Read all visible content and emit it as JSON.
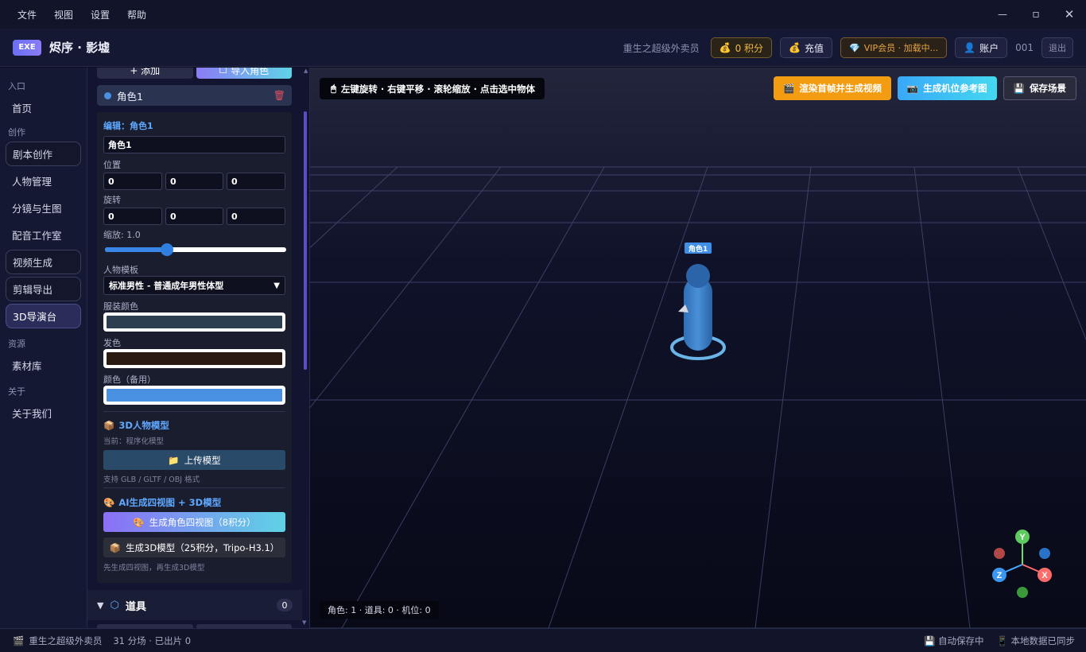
{
  "menubar": {
    "items": [
      "文件",
      "视图",
      "设置",
      "帮助"
    ]
  },
  "window_controls": {
    "minimize": "—",
    "maximize": "▫",
    "close": "✕"
  },
  "topbar": {
    "logo_text": "EXE",
    "title": "烬序 · 影墟",
    "user_name": "重生之超级外卖员",
    "points_label": "0 积分",
    "recharge_label": "充值",
    "vip_label": "VIP会员 · 加载中...",
    "account_label": "账户",
    "user_id": "001",
    "logout_label": "退出"
  },
  "sidebar": {
    "sections": [
      {
        "title": "入口",
        "items": [
          {
            "label": "首页",
            "style": "plain"
          }
        ]
      },
      {
        "title": "创作",
        "items": [
          {
            "label": "剧本创作",
            "style": "boxed"
          },
          {
            "label": "人物管理",
            "style": "plain"
          },
          {
            "label": "分镜与生图",
            "style": "plain"
          },
          {
            "label": "配音工作室",
            "style": "plain"
          },
          {
            "label": "视频生成",
            "style": "boxed"
          },
          {
            "label": "剪辑导出",
            "style": "boxed"
          },
          {
            "label": "3D导演台",
            "style": "active"
          }
        ]
      },
      {
        "title": "资源",
        "items": [
          {
            "label": "素材库",
            "style": "plain"
          }
        ]
      },
      {
        "title": "关于",
        "items": [
          {
            "label": "关于我们",
            "style": "plain"
          }
        ]
      }
    ]
  },
  "panel": {
    "add_label": "+ 添加",
    "import_label": "导入角色",
    "character_name": "角色1",
    "edit_title": "编辑：角色1",
    "name_value": "角色1",
    "position_label": "位置",
    "position": [
      "0",
      "0",
      "0"
    ],
    "rotation_label": "旋转",
    "rotation": [
      "0",
      "0",
      "0"
    ],
    "scale_label": "缩放: 1.0",
    "scale_fraction": 0.34,
    "template_label": "人物模板",
    "template_value": "标准男性 - 普通成年男性体型",
    "outfit_color_label": "服装颜色",
    "outfit_color": "#2d3e50",
    "hair_color_label": "发色",
    "hair_color": "#2b1a12",
    "color_backup_label": "颜色（备用）",
    "color_backup": "#4a90e2",
    "model3d_title": "3D人物模型",
    "current_model": "当前：程序化模型",
    "upload_label": "上传模型",
    "upload_note": "支持 GLB / GLTF / OBJ 格式",
    "ai_title": "AI生成四视图 + 3D模型",
    "gen_views_label": "生成角色四视图（8积分）",
    "gen_3d_label": "生成3D模型（25积分，Tripo-H3.1）",
    "ai_note": "先生成四视图，再生成3D模型",
    "props_title": "道具",
    "props_count": "0"
  },
  "viewport": {
    "hint": "左键旋转 · 右键平移 · 滚轮缩放 · 点击选中物体",
    "render_label": "渲染首帧并生成视频",
    "camera_ref_label": "生成机位参考图",
    "save_scene_label": "保存场景",
    "character_tag": "角色1",
    "status": "角色: 1 · 道具: 0 · 机位: 0",
    "axes": {
      "x": "X",
      "y": "Y",
      "z": "Z"
    }
  },
  "statusbar": {
    "user": "重生之超级外卖员",
    "progress": "31 分场 · 已出片 0",
    "autosave": "自动保存中",
    "sync": "本地数据已同步"
  },
  "colors": {
    "accent": "#6a6ff5",
    "orange": "#f39c12",
    "cyan": "#38a8f8",
    "character": "#3d7fc9"
  }
}
